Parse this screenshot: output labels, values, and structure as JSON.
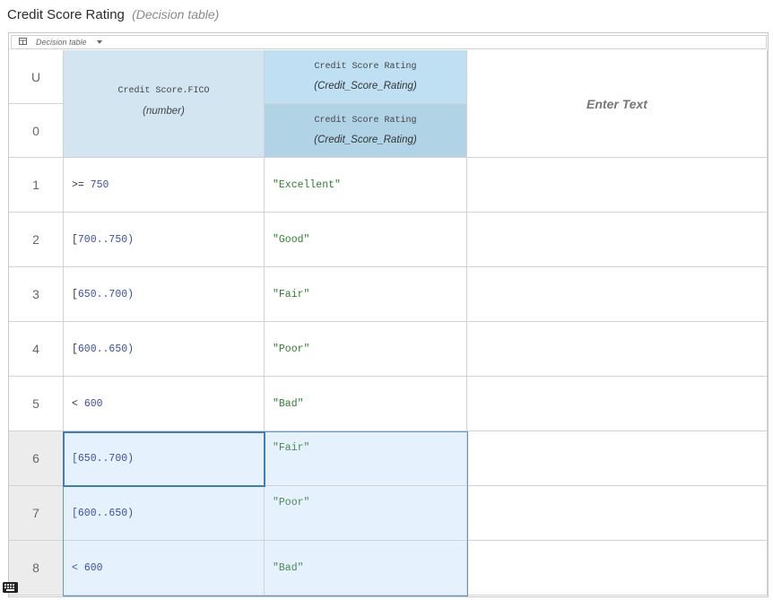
{
  "header": {
    "title": "Credit Score Rating",
    "subtitle": "(Decision table)"
  },
  "toolbar": {
    "label": "Decision table",
    "icon": "table-grid-icon"
  },
  "table": {
    "hit_policy": "U",
    "header_row_number": "0",
    "input_column": {
      "name": "Credit Score.FICO",
      "type": "(number)"
    },
    "output_column": {
      "top_name": "Credit Score Rating",
      "top_type": "(Credit_Score_Rating)",
      "bottom_name": "Credit Score Rating",
      "bottom_type": "(Credit_Score_Rating)"
    },
    "annotation_column": "Enter Text",
    "rows": [
      {
        "num": "1",
        "input_op": ">= ",
        "input_val": "750",
        "output": "\"Excellent\""
      },
      {
        "num": "2",
        "input_op": "[",
        "input_val": "700..750)",
        "output": "\"Good\""
      },
      {
        "num": "3",
        "input_op": "[",
        "input_val": "650..700)",
        "output": "\"Fair\""
      },
      {
        "num": "4",
        "input_op": "[",
        "input_val": "600..650)",
        "output": "\"Poor\""
      },
      {
        "num": "5",
        "input_op": "< ",
        "input_val": "600",
        "output": "\"Bad\""
      },
      {
        "num": "6",
        "input_op": "[",
        "input_val": "650..700)",
        "output": "\"Fair\""
      },
      {
        "num": "7",
        "input_op": "[",
        "input_val": "600..650)",
        "output": "\"Poor\""
      },
      {
        "num": "8",
        "input_op": "< ",
        "input_val": "600",
        "output": "\"Bad\""
      }
    ]
  },
  "selection_color": "#5d9ad1"
}
